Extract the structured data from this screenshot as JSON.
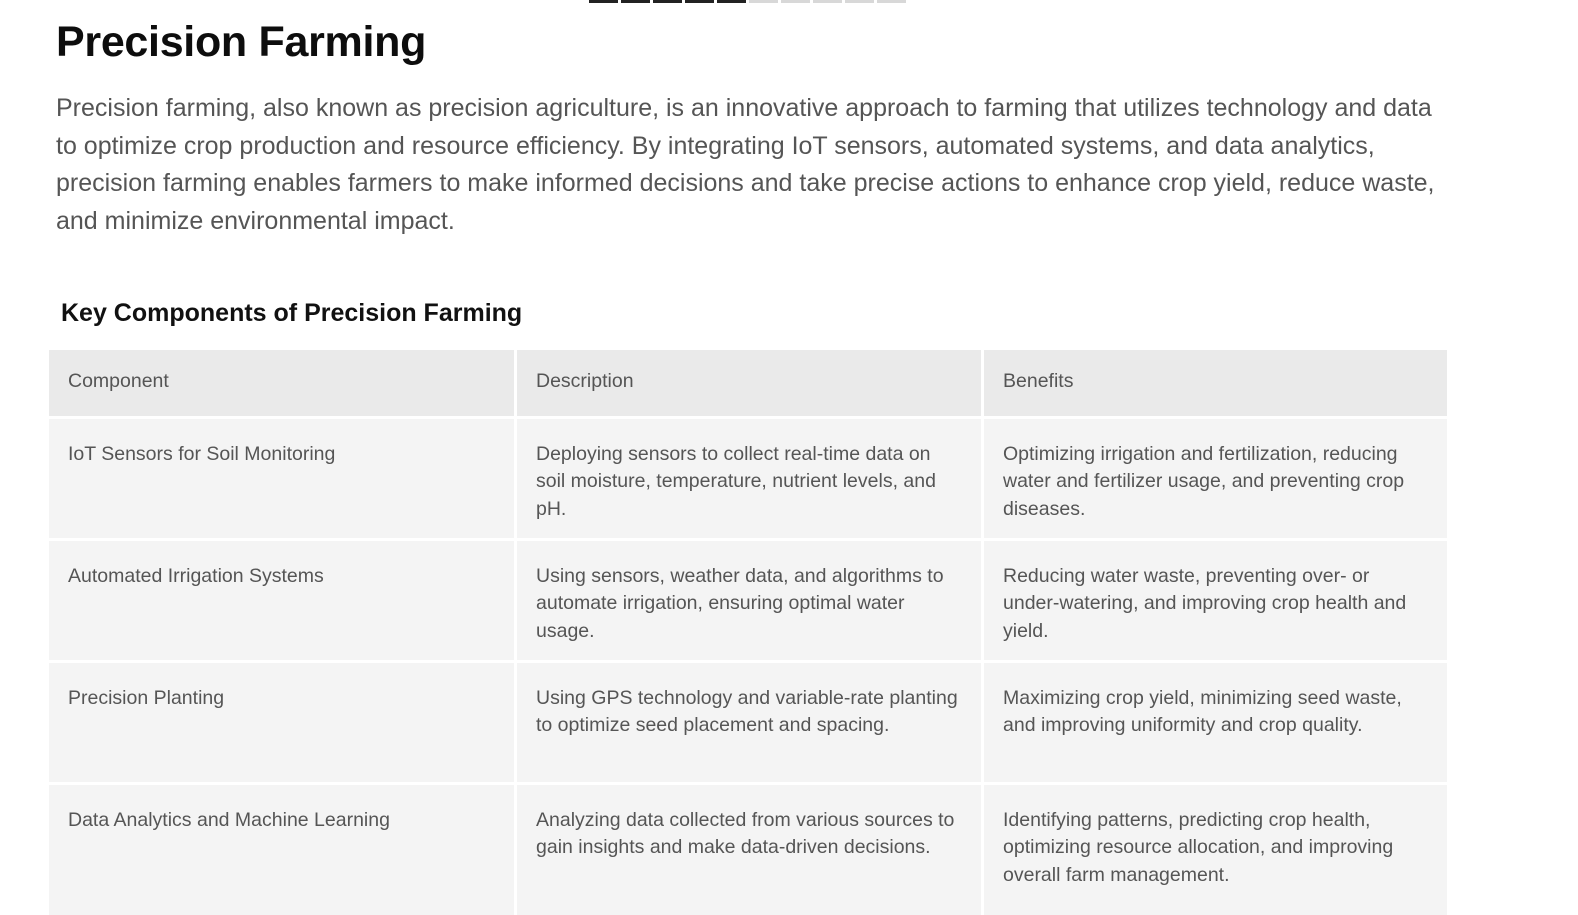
{
  "progress": {
    "filled_segments": 5,
    "total_segments": 10
  },
  "page": {
    "title": "Precision Farming",
    "intro": "Precision farming, also known as precision agriculture, is an innovative approach to farming that utilizes technology and data to optimize crop production and resource efficiency. By integrating IoT sensors, automated systems, and data analytics, precision farming enables farmers to make informed decisions and take precise actions to enhance crop yield, reduce waste, and minimize environmental impact."
  },
  "section": {
    "title": "Key Components of Precision Farming"
  },
  "table": {
    "headers": [
      "Component",
      "Description",
      "Benefits"
    ],
    "rows": [
      {
        "component": "IoT Sensors for Soil Monitoring",
        "description": "Deploying sensors to collect real-time data on soil moisture, temperature, nutrient levels, and pH.",
        "benefits": "Optimizing irrigation and fertilization, reducing water and fertilizer usage, and preventing crop diseases."
      },
      {
        "component": "Automated Irrigation Systems",
        "description": "Using sensors, weather data, and algorithms to automate irrigation, ensuring optimal water usage.",
        "benefits": "Reducing water waste, preventing over- or under-watering, and improving crop health and yield."
      },
      {
        "component": "Precision Planting",
        "description": "Using GPS technology and variable-rate planting to optimize seed placement and spacing.",
        "benefits": "Maximizing crop yield, minimizing seed waste, and improving uniformity and crop quality."
      },
      {
        "component": "Data Analytics and Machine Learning",
        "description": "Analyzing data collected from various sources to gain insights and make data-driven decisions.",
        "benefits": "Identifying patterns, predicting crop health, optimizing resource allocation, and improving overall farm management."
      }
    ]
  }
}
